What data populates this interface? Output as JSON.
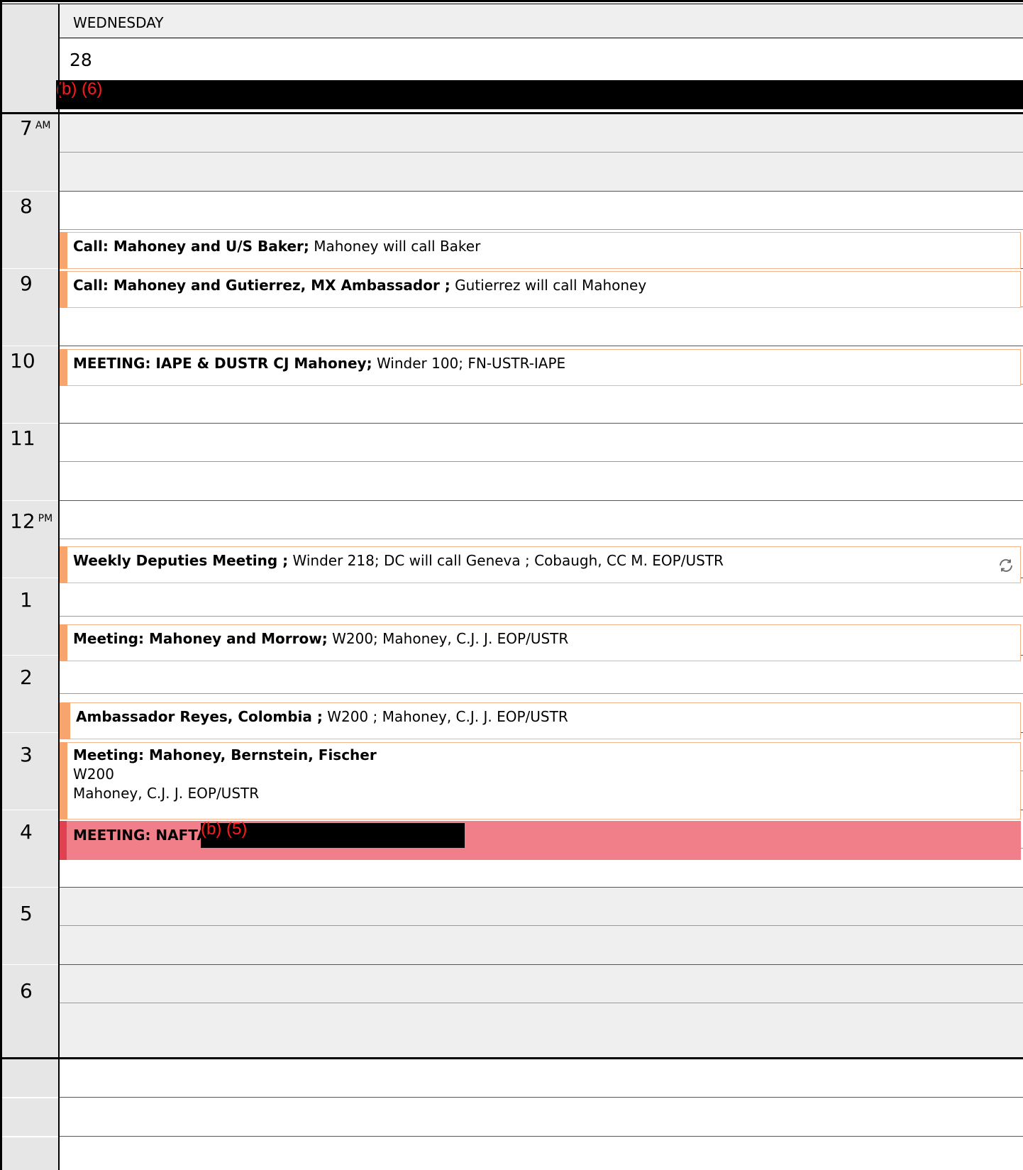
{
  "day": {
    "name": "WEDNESDAY",
    "number": "28"
  },
  "all_day": {
    "redaction": "(b) (6)"
  },
  "hours": [
    {
      "label": "7",
      "ampm": "AM"
    },
    {
      "label": "8",
      "ampm": ""
    },
    {
      "label": "9",
      "ampm": ""
    },
    {
      "label": "10",
      "ampm": ""
    },
    {
      "label": "11",
      "ampm": ""
    },
    {
      "label": "12",
      "ampm": "PM"
    },
    {
      "label": "1",
      "ampm": ""
    },
    {
      "label": "2",
      "ampm": ""
    },
    {
      "label": "3",
      "ampm": ""
    },
    {
      "label": "4",
      "ampm": ""
    },
    {
      "label": "5",
      "ampm": ""
    },
    {
      "label": "6",
      "ampm": ""
    }
  ],
  "events": [
    {
      "title": "Call: Mahoney and U/S Baker;",
      "detail": " Mahoney will call Baker"
    },
    {
      "title": "Call: Mahoney and Gutierrez, MX Ambassador ;",
      "detail": " Gutierrez will call Mahoney"
    },
    {
      "title": "MEETING: IAPE & DUSTR CJ Mahoney;",
      "detail": " Winder 100; FN-USTR-IAPE"
    },
    {
      "title": "Weekly Deputies Meeting ;",
      "detail": " Winder 218; DC will call Geneva ; Cobaugh, CC M. EOP/USTR"
    },
    {
      "title": "Meeting: Mahoney and Morrow;",
      "detail": " W200; Mahoney, C.J. J. EOP/USTR"
    },
    {
      "title": "Ambassador Reyes, Colombia ;",
      "detail": " W200 ; Mahoney, C.J. J. EOP/USTR"
    },
    {
      "title": "Meeting: Mahoney, Bernstein, Fischer",
      "line2": "W200",
      "line3": "Mahoney, C.J. J. EOP/USTR"
    },
    {
      "title": "MEETING: NAFTA",
      "redaction": "(b) (5)"
    }
  ],
  "colors": {
    "event_border": "#f4b38a",
    "event_bar": "#f7a56d",
    "busy_event": "#f07f8a",
    "redaction_text": "#ff1a1a"
  },
  "icons": {
    "recurring": "sync-icon"
  }
}
